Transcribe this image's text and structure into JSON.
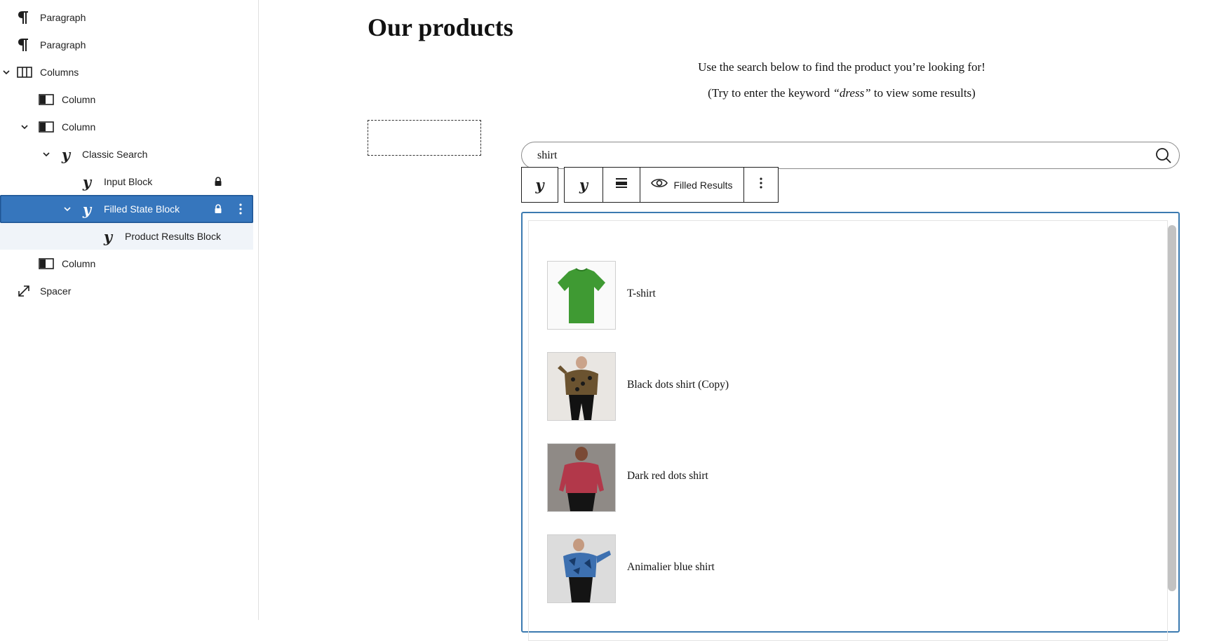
{
  "sidebar": {
    "items": [
      {
        "label": "Paragraph",
        "icon": "paragraph-icon"
      },
      {
        "label": "Paragraph",
        "icon": "paragraph-icon"
      },
      {
        "label": "Columns",
        "icon": "columns-icon"
      },
      {
        "label": "Column",
        "icon": "column-icon"
      },
      {
        "label": "Column",
        "icon": "column-icon"
      },
      {
        "label": "Classic Search",
        "icon": "y-logo-icon"
      },
      {
        "label": "Input Block",
        "icon": "y-logo-icon"
      },
      {
        "label": "Filled State Block",
        "icon": "y-logo-icon"
      },
      {
        "label": "Product Results Block",
        "icon": "y-logo-icon"
      },
      {
        "label": "Column",
        "icon": "column-icon"
      },
      {
        "label": "Spacer",
        "icon": "resize-icon"
      }
    ],
    "selected_color": "#3676bd"
  },
  "page": {
    "title": "Our products",
    "intro_line1": "Use the search below to find the product you’re looking for!",
    "intro_line2_pre": "(Try to enter the keyword ",
    "intro_keyword": "“dress”",
    "intro_line2_post": " to view some results)"
  },
  "search": {
    "value": "shirt"
  },
  "toolbar": {
    "filled_results_label": "Filled Results"
  },
  "results": {
    "products": [
      {
        "name": "T-shirt",
        "image": "green-tshirt"
      },
      {
        "name": "Black dots shirt (Copy)",
        "image": "black-dots-shirt"
      },
      {
        "name": "Dark red dots shirt",
        "image": "dark-red-dots-shirt"
      },
      {
        "name": "Animalier blue shirt",
        "image": "animalier-blue-shirt"
      }
    ],
    "panel_border_color": "#3b7ab0"
  }
}
